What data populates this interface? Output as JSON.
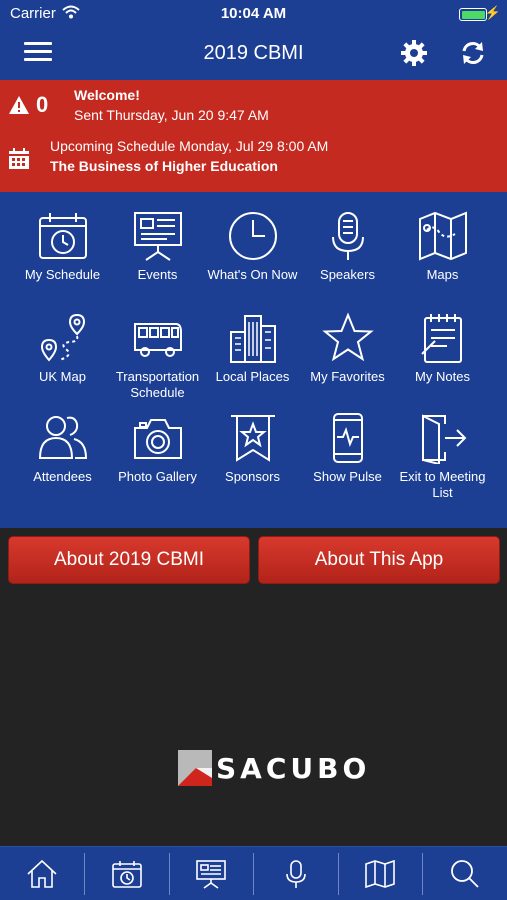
{
  "status_bar": {
    "carrier": "Carrier",
    "time": "10:04 AM",
    "battery_level": 1.0
  },
  "nav": {
    "title": "2019 CBMI",
    "menu_icon": "hamburger-menu-icon",
    "settings_icon": "gear-icon",
    "refresh_icon": "refresh-icon"
  },
  "alerts": {
    "count": "0",
    "welcome_title": "Welcome!",
    "welcome_sent": "Sent Thursday, Jun 20 9:47 AM",
    "upcoming_text": "Upcoming Schedule Monday, Jul 29 8:00 AM",
    "upcoming_event": "The Business of Higher Education"
  },
  "menu": [
    {
      "label": "My Schedule",
      "icon": "calendar-clock-icon"
    },
    {
      "label": "Events",
      "icon": "presentation-board-icon"
    },
    {
      "label": "What's On Now",
      "icon": "clock-icon"
    },
    {
      "label": "Speakers",
      "icon": "microphone-icon"
    },
    {
      "label": "Maps",
      "icon": "folded-map-icon"
    },
    {
      "label": "UK Map",
      "icon": "route-pin-icon"
    },
    {
      "label": "Transportation Schedule",
      "icon": "bus-icon"
    },
    {
      "label": "Local Places",
      "icon": "buildings-icon"
    },
    {
      "label": "My Favorites",
      "icon": "star-icon"
    },
    {
      "label": "My Notes",
      "icon": "notepad-icon"
    },
    {
      "label": "Attendees",
      "icon": "people-icon"
    },
    {
      "label": "Photo Gallery",
      "icon": "camera-icon"
    },
    {
      "label": "Sponsors",
      "icon": "ribbon-star-icon"
    },
    {
      "label": "Show Pulse",
      "icon": "phone-pulse-icon"
    },
    {
      "label": "Exit to Meeting List",
      "icon": "exit-door-icon"
    }
  ],
  "buttons": {
    "about_event": "About 2019 CBMI",
    "about_app": "About This App"
  },
  "logo": {
    "text": "SACUBO"
  },
  "tabs": [
    "home-icon",
    "calendar-clock-icon",
    "presentation-board-icon",
    "microphone-icon",
    "folded-map-icon",
    "search-icon"
  ],
  "colors": {
    "primary_blue": "#1c3f94",
    "alert_red": "#c42a20",
    "button_red": "#c9302a",
    "dark_background": "#232323"
  }
}
